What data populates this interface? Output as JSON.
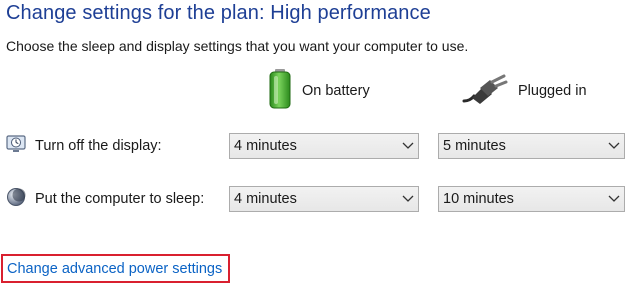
{
  "page": {
    "title": "Change settings for the plan: High performance",
    "subtitle": "Choose the sleep and display settings that you want your computer to use."
  },
  "columns": {
    "on_battery": {
      "label": "On battery",
      "icon": "battery-icon"
    },
    "plugged_in": {
      "label": "Plugged in",
      "icon": "power-plug-icon"
    }
  },
  "settings": {
    "display": {
      "label": "Turn off the display:",
      "icon": "display-monitor-icon",
      "on_battery": "4 minutes",
      "plugged_in": "5 minutes"
    },
    "sleep": {
      "label": "Put the computer to sleep:",
      "icon": "sleep-moon-icon",
      "on_battery": "4 minutes",
      "plugged_in": "10 minutes"
    }
  },
  "links": {
    "advanced": "Change advanced power settings"
  },
  "colors": {
    "title": "#1e3f95",
    "link": "#0b63c5",
    "highlight_border": "#d9202f",
    "battery_green": "#3fae2a"
  }
}
